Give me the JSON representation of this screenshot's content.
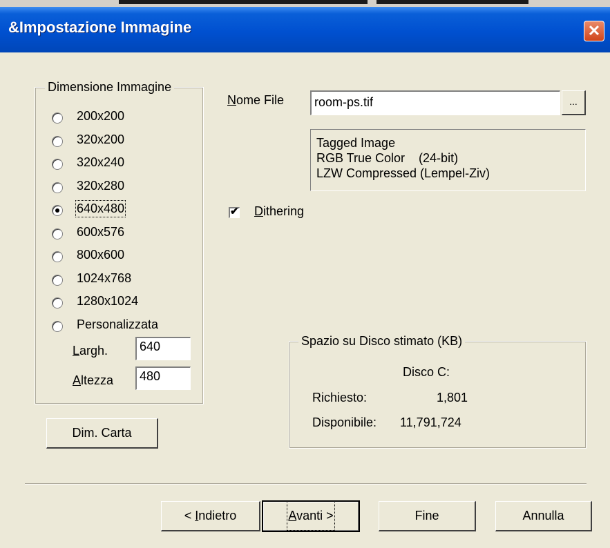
{
  "window": {
    "title": "&Impostazione Immagine",
    "close_glyph": "✕"
  },
  "dimension_group": {
    "label": "Dimensione Immagine",
    "options": [
      {
        "label": "200x200",
        "selected": false
      },
      {
        "label": "320x200",
        "selected": false
      },
      {
        "label": "320x240",
        "selected": false
      },
      {
        "label": "320x280",
        "selected": false
      },
      {
        "label": "640x480",
        "selected": true
      },
      {
        "label": "600x576",
        "selected": false
      },
      {
        "label": "800x600",
        "selected": false
      },
      {
        "label": "1024x768",
        "selected": false
      },
      {
        "label": "1280x1024",
        "selected": false
      },
      {
        "label": "Personalizzata",
        "selected": false
      }
    ],
    "width_label_accel": "L",
    "width_label_rest": "argh.",
    "width_value": "640",
    "height_label_accel": "A",
    "height_label_rest": "ltezza",
    "height_value": "480"
  },
  "paper_button": {
    "label": "Dim. Carta"
  },
  "file": {
    "label_accel": "N",
    "label_rest": "ome File",
    "value": "room-ps.tif",
    "browse_label": "...",
    "info_lines": [
      "Tagged Image",
      "RGB True Color    (24-bit)",
      "LZW Compressed (Lempel-Ziv)"
    ]
  },
  "dithering": {
    "checked": true,
    "check_glyph": "✔",
    "label_accel": "D",
    "label_rest": "ithering"
  },
  "disk_group": {
    "label": "Spazio su Disco stimato (KB)",
    "drive": "Disco C:",
    "required_label": "Richiesto:",
    "required_value": "1,801",
    "available_label": "Disponibile:",
    "available_value": "11,791,724"
  },
  "buttons": {
    "back_prefix": "< ",
    "back_accel": "I",
    "back_rest": "ndietro",
    "next_accel": "A",
    "next_rest": "vanti >",
    "finish": "Fine",
    "cancel": "Annulla"
  }
}
